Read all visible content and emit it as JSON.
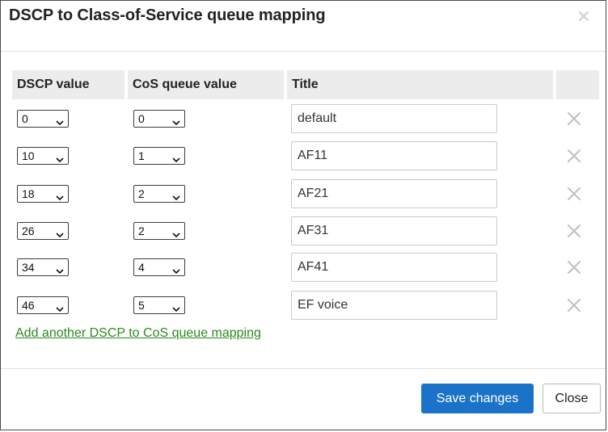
{
  "dialog": {
    "title": "DSCP to Class-of-Service queue mapping",
    "close_icon": "close-icon"
  },
  "table": {
    "headers": [
      "DSCP value",
      "CoS queue value",
      "Title",
      ""
    ],
    "rows": [
      {
        "dscp": "0",
        "cos": "0",
        "title": "default"
      },
      {
        "dscp": "10",
        "cos": "1",
        "title": "AF11"
      },
      {
        "dscp": "18",
        "cos": "2",
        "title": "AF21"
      },
      {
        "dscp": "26",
        "cos": "2",
        "title": "AF31"
      },
      {
        "dscp": "34",
        "cos": "4",
        "title": "AF41"
      },
      {
        "dscp": "46",
        "cos": "5",
        "title": "EF voice"
      }
    ]
  },
  "add_link": "Add another DSCP to CoS queue mapping",
  "footer": {
    "save_label": "Save changes",
    "close_label": "Close"
  },
  "colors": {
    "primary": "#1a73c9",
    "link": "#2a8a1e",
    "header_bg": "#ececec",
    "delete_icon": "#c0c0c0"
  }
}
